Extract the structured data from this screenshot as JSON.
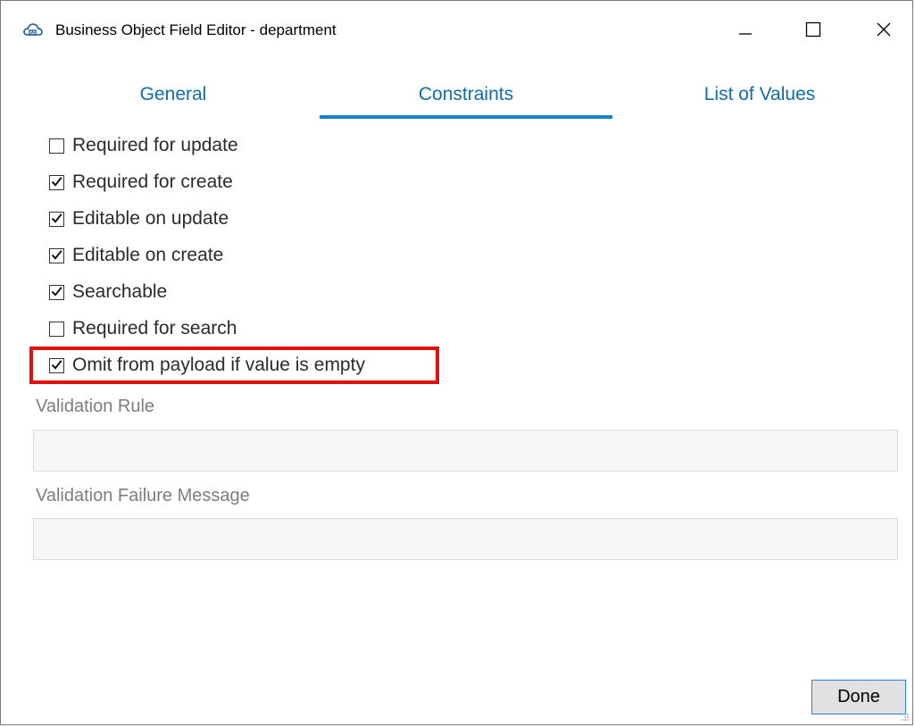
{
  "window": {
    "title": "Business Object Field Editor - department",
    "controls": [
      "minimize-icon",
      "maximize-icon",
      "close-icon"
    ]
  },
  "tabs": [
    {
      "label": "General",
      "active": false
    },
    {
      "label": "Constraints",
      "active": true
    },
    {
      "label": "List of Values",
      "active": false
    }
  ],
  "constraints": [
    {
      "label": "Required for update",
      "checked": false
    },
    {
      "label": "Required for create",
      "checked": true
    },
    {
      "label": "Editable on update",
      "checked": true
    },
    {
      "label": "Editable on create",
      "checked": true
    },
    {
      "label": "Searchable",
      "checked": true
    },
    {
      "label": "Required for search",
      "checked": false
    },
    {
      "label": "Omit from payload if value is empty",
      "checked": true,
      "highlighted": true
    }
  ],
  "validation_rule": {
    "label": "Validation Rule",
    "value": "",
    "placeholder": ""
  },
  "validation_failure_message": {
    "label": "Validation Failure Message",
    "value": "",
    "placeholder": ""
  },
  "footer": {
    "done_label": "Done"
  },
  "colors": {
    "tab_text": "#0f6ea8",
    "tab_underline": "#1584c7",
    "highlight_border": "#e30f0f",
    "button_border": "#2d7fd4"
  }
}
